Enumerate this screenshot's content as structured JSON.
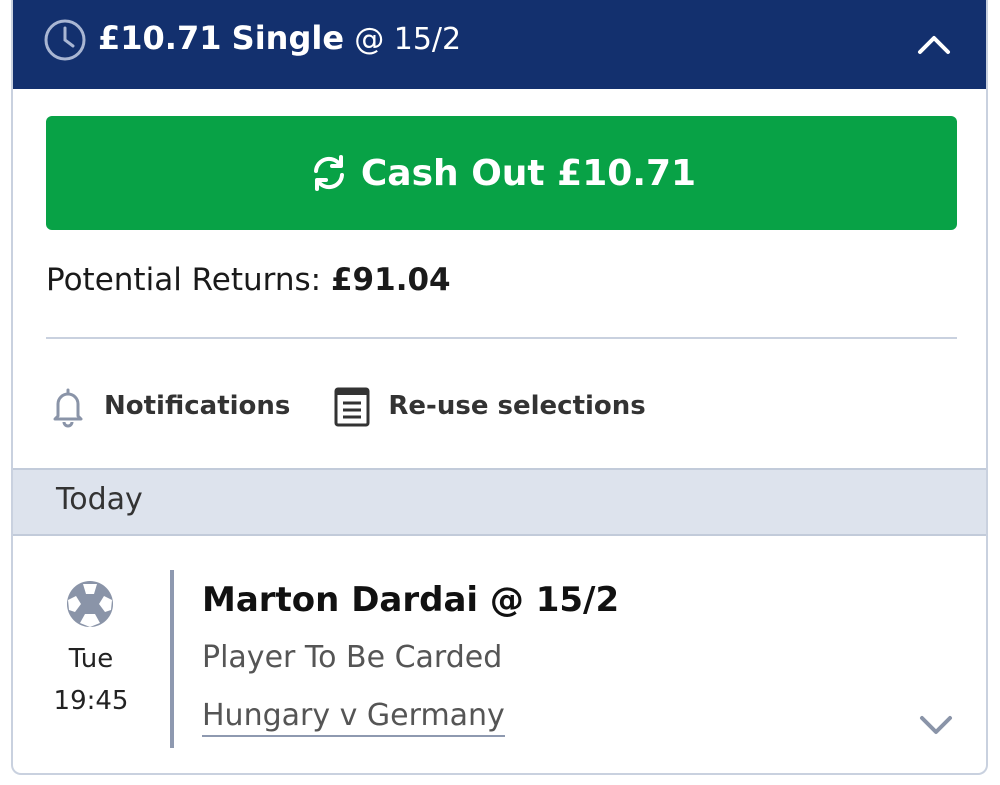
{
  "header": {
    "stake": "£10.71",
    "bet_type": "Single",
    "odds": "@ 15/2",
    "bg_color": "#13306e"
  },
  "cashout": {
    "label": "Cash Out £10.71",
    "icon": "refresh-icon",
    "color": "#08a246"
  },
  "returns": {
    "label": "Potential Returns:",
    "value": "£91.04"
  },
  "actions": [
    {
      "label": "Notifications",
      "icon": "bell-icon"
    },
    {
      "label": "Re-use selections",
      "icon": "document-icon"
    }
  ],
  "section": {
    "label": "Today"
  },
  "event": {
    "sport_icon": "football-icon",
    "day": "Tue",
    "time": "19:45",
    "selection": "Marton Dardai @ 15/2",
    "market": "Player To Be Carded",
    "match": "Hungary v Germany"
  }
}
